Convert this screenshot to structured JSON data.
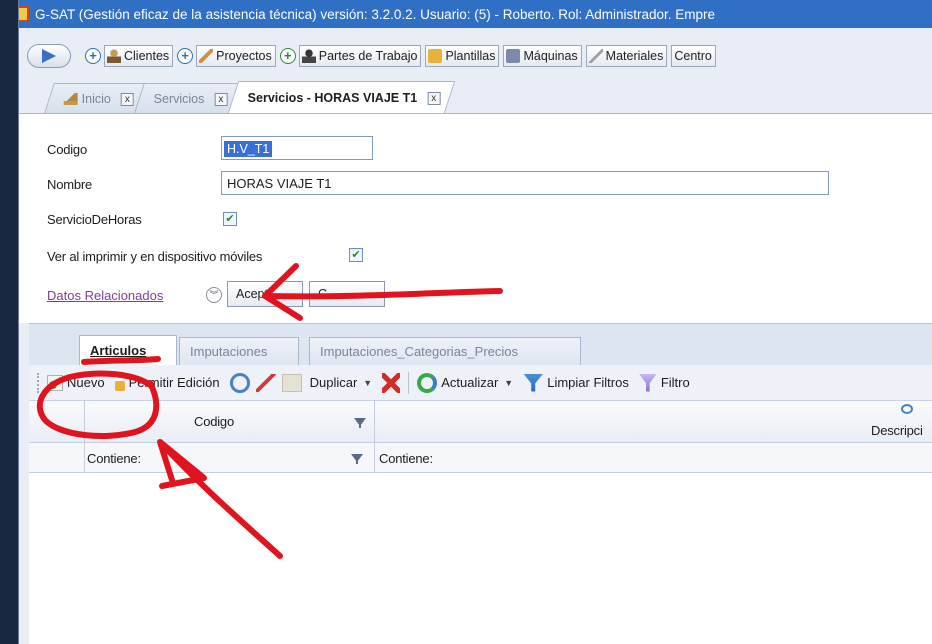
{
  "window": {
    "title": "G-SAT (Gestión eficaz de la asistencia técnica) versión: 3.2.0.2. Usuario:  (5) - Roberto. Rol: Administrador. Empre"
  },
  "toolbar": {
    "items": [
      {
        "label": "Clientes",
        "icon": "client-icon"
      },
      {
        "label": "Proyectos",
        "icon": "ruler-icon"
      },
      {
        "label": "Partes de Trabajo",
        "icon": "worker-icon"
      },
      {
        "label": "Plantillas",
        "icon": "template-icon"
      },
      {
        "label": "Máquinas",
        "icon": "machine-icon"
      },
      {
        "label": "Materiales",
        "icon": "material-icon"
      },
      {
        "label": "Centro",
        "icon": ""
      }
    ]
  },
  "doc_tabs": [
    {
      "label": "Inicio",
      "close": "x"
    },
    {
      "label": "Servicios",
      "close": "x"
    },
    {
      "label": "Servicios - HORAS VIAJE T1",
      "close": "x"
    }
  ],
  "form": {
    "codigo_label": "Codigo",
    "codigo_value": "H.V_T1",
    "nombre_label": "Nombre",
    "nombre_value": "HORAS VIAJE T1",
    "servicio_horas_label": "ServicioDeHoras",
    "servicio_horas_checked": true,
    "ver_imprimir_label": "Ver al imprimir y en dispositivo móviles",
    "ver_imprimir_checked": true,
    "datos_relacionados": "Datos Relacionados",
    "aceptar_visible": "Acept",
    "cancelar_visible": "C"
  },
  "sub_tabs": [
    {
      "label": "Articulos",
      "active": true
    },
    {
      "label": "Imputaciones",
      "active": false
    },
    {
      "label": "Imputaciones_Categorias_Precios",
      "active": false
    }
  ],
  "grid_toolbar": {
    "nuevo": "Nuevo",
    "permitir_edicion": "Permitir Edición",
    "duplicar": "Duplicar",
    "actualizar": "Actualizar",
    "limpiar_filtros": "Limpiar Filtros",
    "filtros": "Filtro"
  },
  "grid": {
    "col_codigo": "Codigo",
    "col_descripcion": "Descripci",
    "filter_codigo": "Contiene:",
    "filter_descripcion": "Contiene:"
  },
  "colors": {
    "titlebar": "#2f6fc4",
    "annotation": "#e0141e",
    "link": "#7a3f9a"
  }
}
